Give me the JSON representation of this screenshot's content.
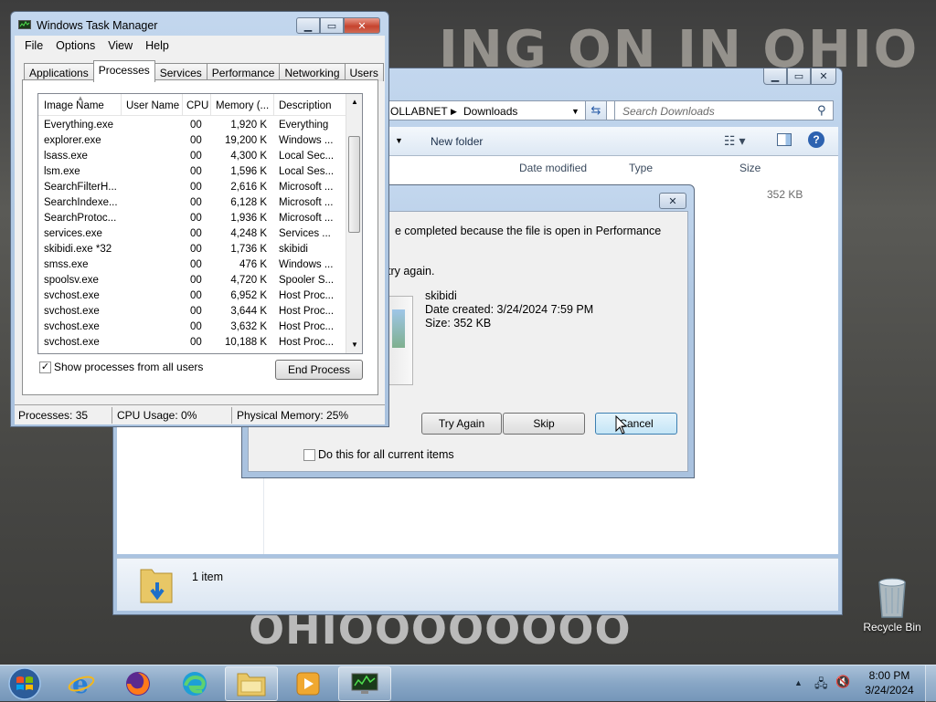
{
  "desktop": {
    "bg_text_top": "ING ON IN OHIO",
    "bg_text_bottom": "OHIOOOOOOOO",
    "recycle_bin_label": "Recycle Bin"
  },
  "explorer": {
    "breadcrumb_part1": "OLLABNET",
    "breadcrumb_part2": "Downloads",
    "search_placeholder": "Search Downloads",
    "new_folder": "New folder",
    "columns": {
      "date": "Date modified",
      "type": "Type",
      "size": "Size"
    },
    "file_size": "352 KB",
    "status_text": "1 item"
  },
  "dialog": {
    "message": "e completed because the file is open in Performance",
    "retry_text": "try again.",
    "file_name": "skibidi",
    "date_created": "Date created: 3/24/2024 7:59 PM",
    "size": "Size: 352 KB",
    "try_again": "Try Again",
    "skip": "Skip",
    "cancel": "Cancel",
    "do_this_all": "Do this for all current items"
  },
  "taskmgr": {
    "title": "Windows Task Manager",
    "menu": [
      "File",
      "Options",
      "View",
      "Help"
    ],
    "tabs": [
      "Applications",
      "Processes",
      "Services",
      "Performance",
      "Networking",
      "Users"
    ],
    "headers": {
      "image": "Image Name",
      "user": "User Name",
      "cpu": "CPU",
      "mem": "Memory (...",
      "desc": "Description"
    },
    "processes": [
      {
        "name": "Everything.exe",
        "cpu": "00",
        "mem": "1,920 K",
        "desc": "Everything"
      },
      {
        "name": "explorer.exe",
        "cpu": "00",
        "mem": "19,200 K",
        "desc": "Windows ..."
      },
      {
        "name": "lsass.exe",
        "cpu": "00",
        "mem": "4,300 K",
        "desc": "Local Sec..."
      },
      {
        "name": "lsm.exe",
        "cpu": "00",
        "mem": "1,596 K",
        "desc": "Local Ses..."
      },
      {
        "name": "SearchFilterH...",
        "cpu": "00",
        "mem": "2,616 K",
        "desc": "Microsoft ..."
      },
      {
        "name": "SearchIndexe...",
        "cpu": "00",
        "mem": "6,128 K",
        "desc": "Microsoft ..."
      },
      {
        "name": "SearchProtoc...",
        "cpu": "00",
        "mem": "1,936 K",
        "desc": "Microsoft ..."
      },
      {
        "name": "services.exe",
        "cpu": "00",
        "mem": "4,248 K",
        "desc": "Services ..."
      },
      {
        "name": "skibidi.exe *32",
        "cpu": "00",
        "mem": "1,736 K",
        "desc": "skibidi"
      },
      {
        "name": "smss.exe",
        "cpu": "00",
        "mem": "476 K",
        "desc": "Windows ..."
      },
      {
        "name": "spoolsv.exe",
        "cpu": "00",
        "mem": "4,720 K",
        "desc": "Spooler S..."
      },
      {
        "name": "svchost.exe",
        "cpu": "00",
        "mem": "6,952 K",
        "desc": "Host Proc..."
      },
      {
        "name": "svchost.exe",
        "cpu": "00",
        "mem": "3,644 K",
        "desc": "Host Proc..."
      },
      {
        "name": "svchost.exe",
        "cpu": "00",
        "mem": "3,632 K",
        "desc": "Host Proc..."
      },
      {
        "name": "svchost.exe",
        "cpu": "00",
        "mem": "10,188 K",
        "desc": "Host Proc..."
      }
    ],
    "show_all_users": "Show processes from all users",
    "end_process": "End Process",
    "status": {
      "processes": "Processes: 35",
      "cpu": "CPU Usage: 0%",
      "memory": "Physical Memory: 25%"
    }
  },
  "taskbar": {
    "time": "8:00 PM",
    "date": "3/24/2024"
  }
}
